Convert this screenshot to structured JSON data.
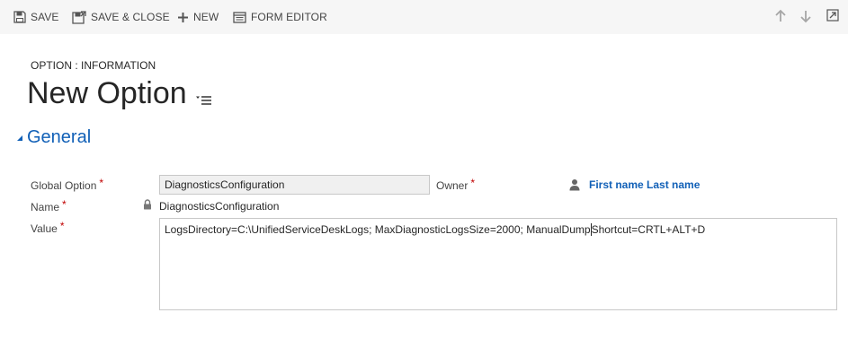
{
  "toolbar": {
    "save_label": "SAVE",
    "save_close_label": "SAVE & CLOSE",
    "new_label": "NEW",
    "form_editor_label": "FORM EDITOR"
  },
  "header": {
    "entity_label": "OPTION : INFORMATION",
    "title": "New Option"
  },
  "section": {
    "title": "General"
  },
  "fields": {
    "global_option": {
      "label": "Global Option",
      "required": "*",
      "value": "DiagnosticsConfiguration"
    },
    "owner": {
      "label": "Owner",
      "required": "*",
      "value": "First name Last name"
    },
    "name": {
      "label": "Name",
      "required": "*",
      "value": "DiagnosticsConfiguration"
    },
    "value": {
      "label": "Value",
      "required": "*",
      "text_before_caret": "LogsDirectory=C:\\UnifiedServiceDeskLogs; MaxDiagnosticLogsSize=2000; ManualDump",
      "text_after_caret": "Shortcut=CRTL+ALT+D"
    }
  },
  "colors": {
    "accent": "#1160b7",
    "required": "#c00000",
    "toolbar_bg": "#f6f6f6"
  },
  "icons": {
    "save": "save-icon",
    "save_close": "save-close-icon",
    "new": "plus-icon",
    "form_editor": "form-editor-icon",
    "up": "arrow-up-icon",
    "down": "arrow-down-icon",
    "popout": "popout-icon",
    "form_selector": "form-selector-icon",
    "collapse": "collapse-triangle-icon",
    "owner": "person-icon",
    "lock": "lock-icon"
  }
}
